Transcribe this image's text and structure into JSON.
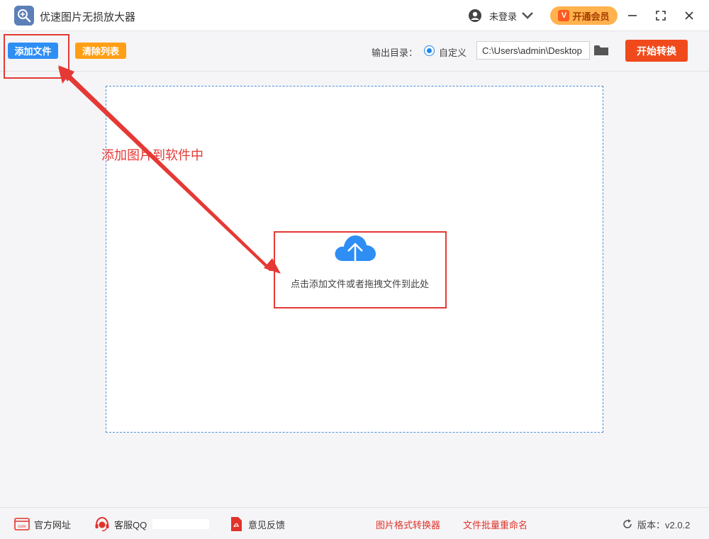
{
  "titlebar": {
    "app_title": "优速图片无损放大器",
    "user_label": "未登录",
    "vip_badge": "V",
    "vip_label": "开通会员"
  },
  "toolbar": {
    "add_label": "添加文件",
    "clear_label": "清除列表",
    "output_label": "输出目录：",
    "radio_label": "自定义",
    "path_value": "C:\\Users\\admin\\Desktop",
    "start_label": "开始转换"
  },
  "dropzone": {
    "hint": "点击添加文件或者拖拽文件到此处"
  },
  "annotation": {
    "label": "添加图片到软件中",
    "color": "#e53935"
  },
  "footer": {
    "website": "官方网址",
    "qq": "客服QQ",
    "feedback": "意见反馈",
    "format_converter": "图片格式转换器",
    "batch_rename": "文件批量重命名",
    "version": "版本：v2.0.2"
  },
  "colors": {
    "primary_blue": "#2e8ef4",
    "orange": "#ff9f16",
    "start_red": "#f04a1c",
    "vip_gold": "#ffb24d"
  }
}
